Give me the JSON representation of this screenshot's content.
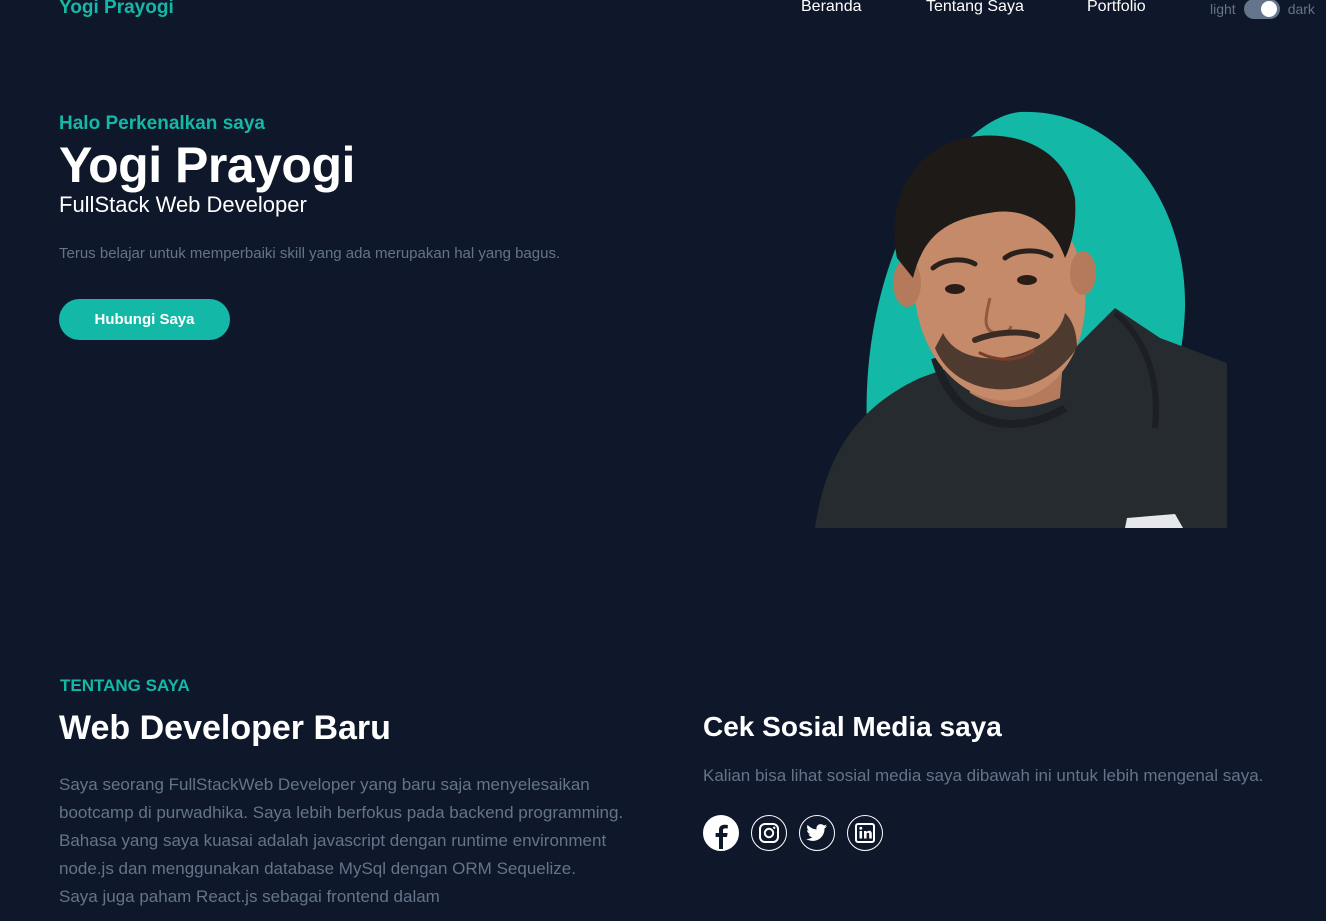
{
  "header": {
    "brand": "Yogi Prayogi",
    "nav": [
      "Beranda",
      "Tentang Saya",
      "Portfolio"
    ],
    "theme": {
      "light_label": "light",
      "dark_label": "dark",
      "current": "dark"
    }
  },
  "hero": {
    "greeting": "Halo Perkenalkan saya",
    "name": "Yogi Prayogi",
    "role": "FullStack Web Developer",
    "tagline": "Terus belajar untuk memperbaiki skill yang ada merupakan hal yang bagus.",
    "cta_label": "Hubungi Saya"
  },
  "about": {
    "kicker": "TENTANG SAYA",
    "title": "Web Developer Baru",
    "paragraphs": [
      "Saya seorang FullStackWeb Developer yang baru saja menyelesaikan bootcamp di purwadhika. Saya lebih berfokus pada backend programming. Bahasa yang saya kuasai adalah javascript dengan runtime environment node.js dan menggunakan database MySql dengan ORM Sequelize.",
      "Saya juga paham React.js sebagai frontend dalam"
    ]
  },
  "social": {
    "title": "Cek Sosial Media saya",
    "text": "Kalian bisa lihat sosial media saya dibawah ini untuk lebih mengenal saya.",
    "icons": [
      "facebook-icon",
      "instagram-icon",
      "twitter-icon",
      "linkedin-icon"
    ]
  },
  "colors": {
    "background": "#0f172a",
    "accent": "#14b8a6",
    "muted_text": "#64748b",
    "text": "#ffffff"
  }
}
